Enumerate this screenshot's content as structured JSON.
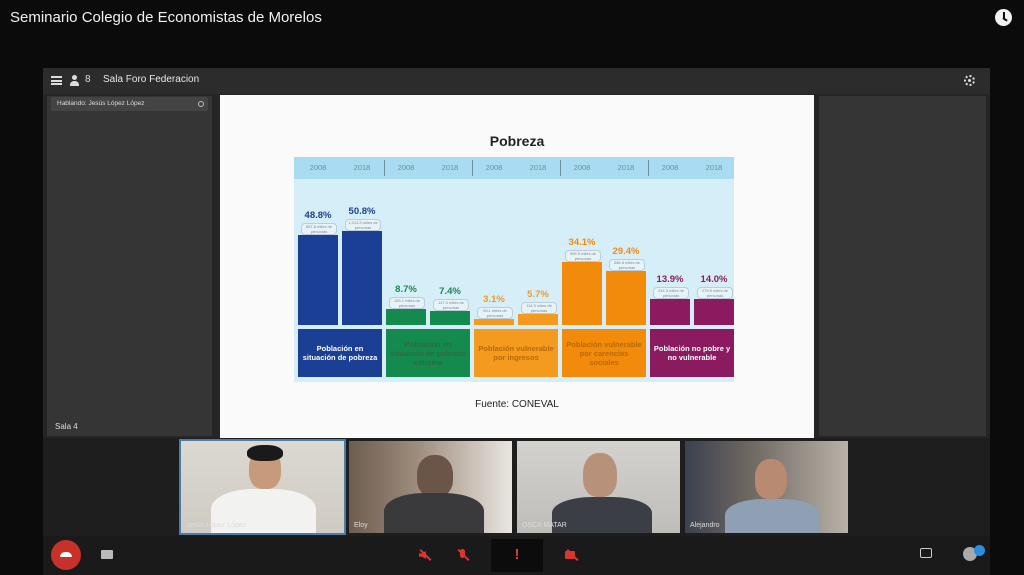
{
  "video_title": "Seminario Colegio de Economistas de Morelos",
  "topbar": {
    "participants_count": "8",
    "room_name": "Sala Foro Federacion"
  },
  "speaking_label": "Hablando: Jesús López López",
  "slide": {
    "title": "Pobreza",
    "source": "Fuente: CONEVAL",
    "chart_data": {
      "type": "bar",
      "title": "Pobreza",
      "categories": [
        "Población en situación de pobreza",
        "Población en situación de pobreza extrema",
        "Población vulnerable por ingresos",
        "Población vulnerable por carencias sociales",
        "Población no pobre y no vulnerable"
      ],
      "years": [
        "2008",
        "2018"
      ],
      "colors": [
        "#1b3f95",
        "#158a4f",
        "#f39a1f",
        "#f28a0c",
        "#8b1b5e"
      ],
      "groups": [
        {
          "category": "Población en situación de pobreza",
          "values": [
            48.8,
            50.8
          ],
          "labels": [
            "48.8%",
            "50.8%"
          ],
          "notes": [
            "857.6 miles de personas",
            "1,013.3 miles de personas"
          ]
        },
        {
          "category": "Población en situación de pobreza extrema",
          "values": [
            8.7,
            7.4
          ],
          "labels": [
            "8.7%",
            "7.4%"
          ],
          "notes": [
            "153.1 miles de personas",
            "147.0 miles de personas"
          ]
        },
        {
          "category": "Población vulnerable por ingresos",
          "values": [
            3.1,
            5.7
          ],
          "labels": [
            "3.1%",
            "5.7%"
          ],
          "notes": [
            "55.1 miles de personas",
            "114.5 miles de personas"
          ]
        },
        {
          "category": "Población vulnerable por carencias sociales",
          "values": [
            34.1,
            29.4
          ],
          "labels": [
            "34.1%",
            "29.4%"
          ],
          "notes": [
            "599.5 miles de personas",
            "586.8 miles de personas"
          ]
        },
        {
          "category": "Población no pobre y no vulnerable",
          "values": [
            13.9,
            14.0
          ],
          "labels": [
            "13.9%",
            "14.0%"
          ],
          "notes": [
            "244.3 miles de personas",
            "279.6 miles de personas"
          ]
        }
      ],
      "source": "Fuente: CONEVAL"
    }
  },
  "room_label": "Sala 4",
  "participants": [
    {
      "name": "Jesus López López"
    },
    {
      "name": "Eloy"
    },
    {
      "name": "OSCA MATAR"
    },
    {
      "name": "Alejandro"
    }
  ],
  "colors": {
    "hangup": "#c8302a",
    "muted": "#d9362e",
    "active_tile": "#4a7ea8"
  }
}
